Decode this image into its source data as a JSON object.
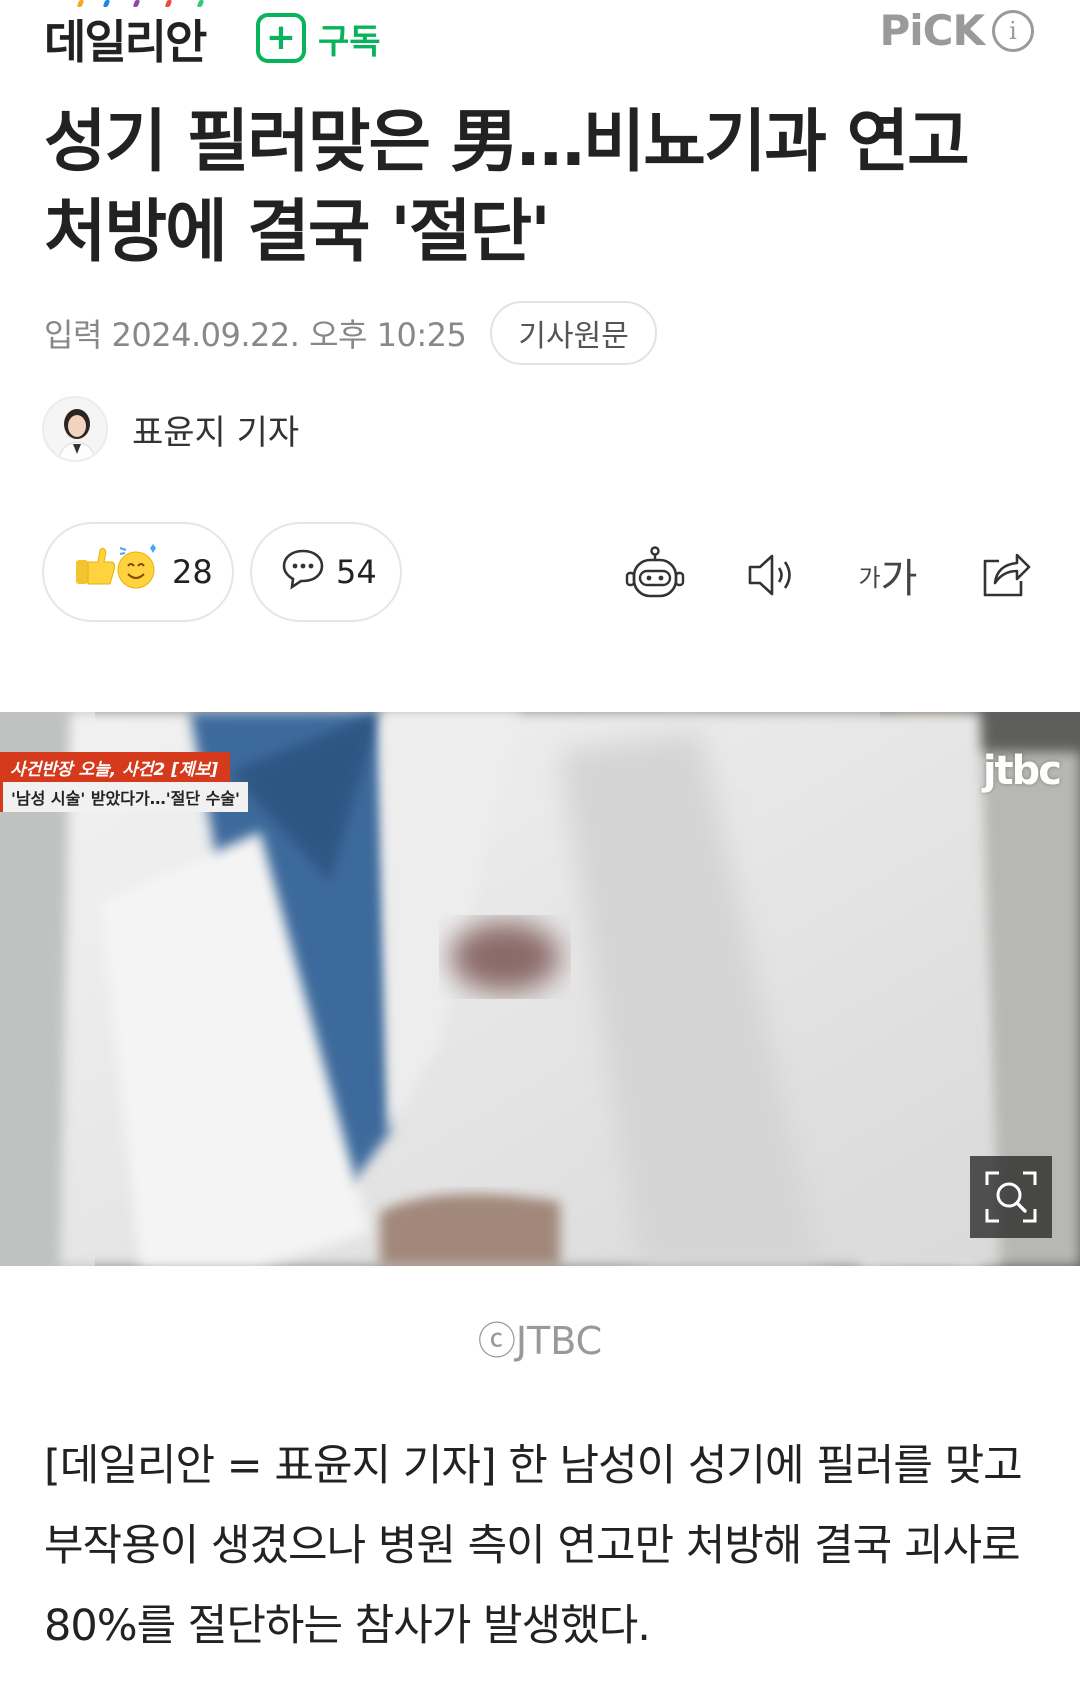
{
  "header": {
    "brand": "데일리안",
    "subscribe_label": "구독",
    "subscribe_icon": "+",
    "pick_label": "PiCK",
    "info_icon": "i"
  },
  "article": {
    "title": "성기 필러맞은 男…비뇨기과 연고 처방에 결국 '절단'",
    "date": "입력 2024.09.22. 오후 10:25",
    "original_button": "기사원문",
    "reporter": "표윤지 기자",
    "reactions_count": "28",
    "comments_count": "54",
    "font_tool_small": "가",
    "font_tool_large": "가",
    "image": {
      "tag_line1": "사건반장 오늘, 사건2 [제보]",
      "tag_line2": "'남성 시술' 받았다가…'절단 수술'",
      "logo": "jtbc",
      "credit": "ⓒJTBC"
    },
    "body": "[데일리안 = 표윤지 기자] 한 남성이 성기에 필러를 맞고 부작용이 생겼으나 병원 측이 연고만 처방해 결국 괴사로 80%를 절단하는 참사가 발생했다."
  },
  "colors": {
    "accent_green": "#08b45a",
    "muted_gray": "#9a9a9a",
    "news_red": "#d63a1c"
  },
  "icons": [
    "plus-icon",
    "info-icon",
    "reaction-icon",
    "comment-icon",
    "robot-icon",
    "speaker-icon",
    "font-size-icon",
    "share-icon",
    "zoom-icon"
  ]
}
